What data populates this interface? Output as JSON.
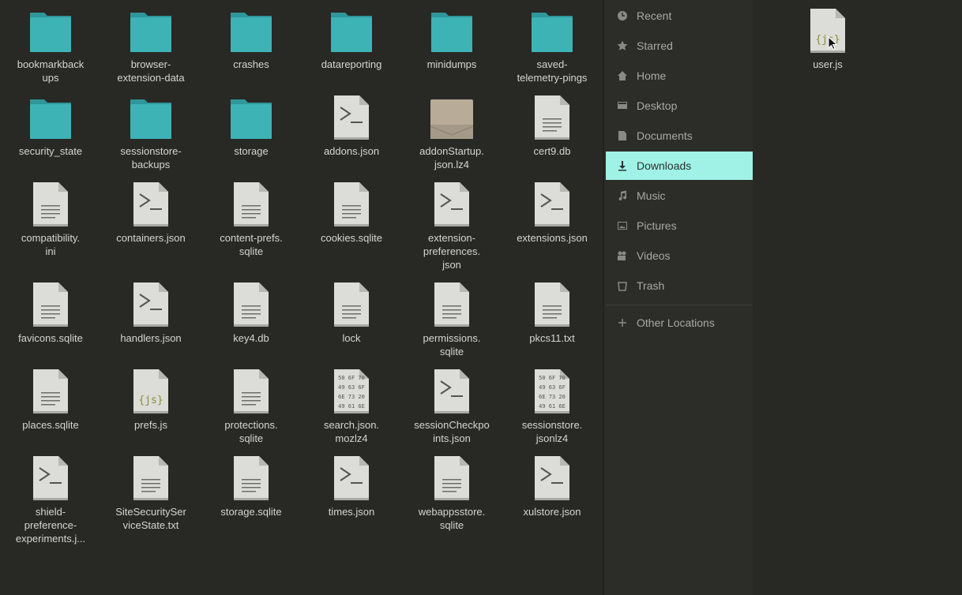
{
  "colors": {
    "background": "#282825",
    "sidebar_bg": "#2c2c29",
    "folder": "#3db3b6",
    "active_item": "#a0f2e6",
    "doc": "#dcdcd8",
    "js_glyph": "#8a8f3a"
  },
  "files": [
    {
      "name": "bookmarkbackups",
      "label": "bookmarkback\nups",
      "icon": "folder-icon"
    },
    {
      "name": "browser-extension-data",
      "label": "browser-\nextension-data",
      "icon": "folder-icon"
    },
    {
      "name": "crashes",
      "label": "crashes",
      "icon": "folder-icon"
    },
    {
      "name": "datareporting",
      "label": "datareporting",
      "icon": "folder-icon"
    },
    {
      "name": "minidumps",
      "label": "minidumps",
      "icon": "folder-icon"
    },
    {
      "name": "saved-telemetry-pings",
      "label": "saved-\ntelemetry-pings",
      "icon": "folder-icon"
    },
    {
      "name": "security_state",
      "label": "security_state",
      "icon": "folder-icon"
    },
    {
      "name": "sessionstore-backups",
      "label": "sessionstore-\nbackups",
      "icon": "folder-icon"
    },
    {
      "name": "storage",
      "label": "storage",
      "icon": "folder-icon"
    },
    {
      "name": "addons.json",
      "label": "addons.json",
      "icon": "script-file-icon"
    },
    {
      "name": "addonStartup.json.lz4",
      "label": "addonStartup.\njson.lz4",
      "icon": "archive-file-icon"
    },
    {
      "name": "cert9.db",
      "label": "cert9.db",
      "icon": "text-file-icon"
    },
    {
      "name": "compatibility.ini",
      "label": "compatibility.\nini",
      "icon": "text-file-icon"
    },
    {
      "name": "containers.json",
      "label": "containers.json",
      "icon": "script-file-icon"
    },
    {
      "name": "content-prefs.sqlite",
      "label": "content-prefs.\nsqlite",
      "icon": "text-file-icon"
    },
    {
      "name": "cookies.sqlite",
      "label": "cookies.sqlite",
      "icon": "text-file-icon"
    },
    {
      "name": "extension-preferences.json",
      "label": "extension-\npreferences.\njson",
      "icon": "script-file-icon"
    },
    {
      "name": "extensions.json",
      "label": "extensions.json",
      "icon": "script-file-icon"
    },
    {
      "name": "favicons.sqlite",
      "label": "favicons.sqlite",
      "icon": "text-file-icon"
    },
    {
      "name": "handlers.json",
      "label": "handlers.json",
      "icon": "script-file-icon"
    },
    {
      "name": "key4.db",
      "label": "key4.db",
      "icon": "text-file-icon"
    },
    {
      "name": "lock",
      "label": "lock",
      "icon": "text-file-icon"
    },
    {
      "name": "permissions.sqlite",
      "label": "permissions.\nsqlite",
      "icon": "text-file-icon"
    },
    {
      "name": "pkcs11.txt",
      "label": "pkcs11.txt",
      "icon": "text-file-icon"
    },
    {
      "name": "places.sqlite",
      "label": "places.sqlite",
      "icon": "text-file-icon"
    },
    {
      "name": "prefs.js",
      "label": "prefs.js",
      "icon": "js-file-icon"
    },
    {
      "name": "protections.sqlite",
      "label": "protections.\nsqlite",
      "icon": "text-file-icon"
    },
    {
      "name": "search.json.mozlz4",
      "label": "search.json.\nmozlz4",
      "icon": "binary-file-icon"
    },
    {
      "name": "sessionCheckpoints.json",
      "label": "sessionCheckpo\nints.json",
      "icon": "script-file-icon"
    },
    {
      "name": "sessionstore.jsonlz4",
      "label": "sessionstore.\njsonlz4",
      "icon": "binary-file-icon"
    },
    {
      "name": "shield-preference-experiments.json",
      "label": "shield-\npreference-\nexperiments.j...",
      "icon": "script-file-icon"
    },
    {
      "name": "SiteSecurityServiceState.txt",
      "label": "SiteSecuritySer\nviceState.txt",
      "icon": "text-file-icon"
    },
    {
      "name": "storage.sqlite",
      "label": "storage.sqlite",
      "icon": "text-file-icon"
    },
    {
      "name": "times.json",
      "label": "times.json",
      "icon": "script-file-icon"
    },
    {
      "name": "webappsstore.sqlite",
      "label": "webappsstore.\nsqlite",
      "icon": "text-file-icon"
    },
    {
      "name": "xulstore.json",
      "label": "xulstore.json",
      "icon": "script-file-icon"
    }
  ],
  "sidebar": {
    "items": [
      {
        "label": "Recent",
        "icon": "clock-icon",
        "active": false
      },
      {
        "label": "Starred",
        "icon": "star-icon",
        "active": false
      },
      {
        "label": "Home",
        "icon": "home-icon",
        "active": false
      },
      {
        "label": "Desktop",
        "icon": "desktop-icon",
        "active": false
      },
      {
        "label": "Documents",
        "icon": "document-icon",
        "active": false
      },
      {
        "label": "Downloads",
        "icon": "download-icon",
        "active": true
      },
      {
        "label": "Music",
        "icon": "music-icon",
        "active": false
      },
      {
        "label": "Pictures",
        "icon": "picture-icon",
        "active": false
      },
      {
        "label": "Videos",
        "icon": "video-icon",
        "active": false
      },
      {
        "label": "Trash",
        "icon": "trash-icon",
        "active": false
      }
    ],
    "other_locations": {
      "label": "Other Locations",
      "icon": "plus-icon"
    }
  },
  "right_pane": {
    "file": {
      "name": "user.js",
      "label": "user.js",
      "icon": "js-file-icon"
    }
  },
  "binary_glyph_rows": [
    "50 6F 70",
    "49 63 6F",
    "6E 73 20",
    "49 61 6E"
  ],
  "js_glyph": "{js}"
}
